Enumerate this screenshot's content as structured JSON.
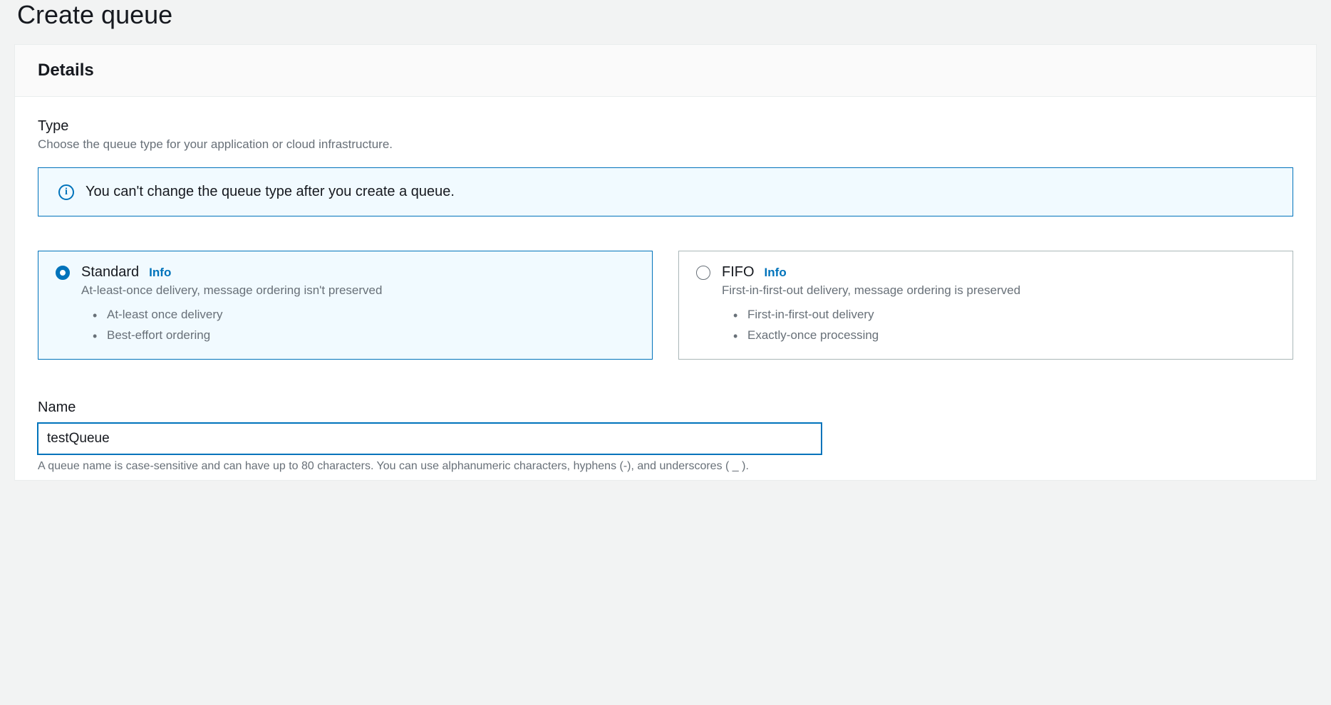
{
  "page": {
    "title": "Create queue"
  },
  "details": {
    "heading": "Details",
    "type": {
      "label": "Type",
      "description": "Choose the queue type for your application or cloud infrastructure.",
      "banner": "You can't change the queue type after you create a queue.",
      "options": {
        "standard": {
          "title": "Standard",
          "info": "Info",
          "subtitle": "At-least-once delivery, message ordering isn't preserved",
          "bullets": [
            "At-least once delivery",
            "Best-effort ordering"
          ],
          "selected": true
        },
        "fifo": {
          "title": "FIFO",
          "info": "Info",
          "subtitle": "First-in-first-out delivery, message ordering is preserved",
          "bullets": [
            "First-in-first-out delivery",
            "Exactly-once processing"
          ],
          "selected": false
        }
      }
    },
    "name": {
      "label": "Name",
      "value": "testQueue",
      "help": "A queue name is case-sensitive and can have up to 80 characters. You can use alphanumeric characters, hyphens (-), and underscores ( _ )."
    }
  }
}
